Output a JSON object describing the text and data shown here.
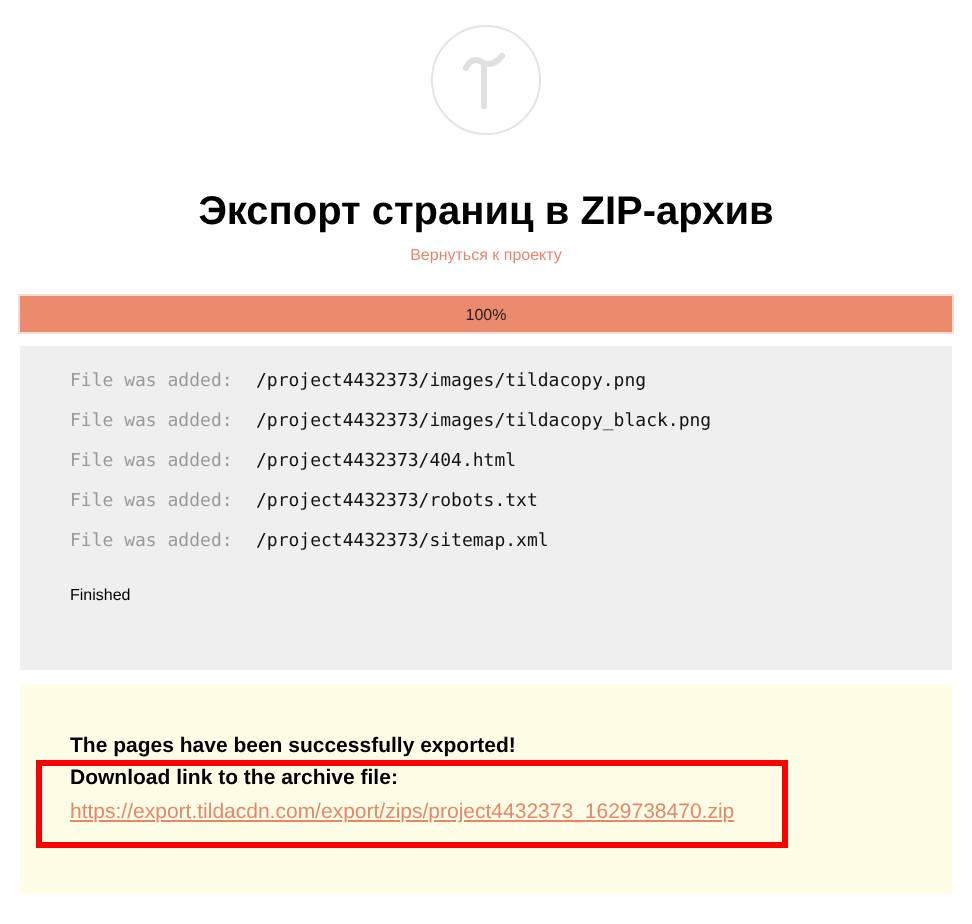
{
  "title": "Экспорт страниц в ZIP-архив",
  "back_link": "Вернуться к проекту",
  "progress": {
    "level": 1,
    "label": "100%"
  },
  "log": {
    "rows": [
      {
        "prefix": "File was added:",
        "path": "/project4432373/images/tildacopy.png"
      },
      {
        "prefix": "File was added:",
        "path": "/project4432373/images/tildacopy_black.png"
      },
      {
        "prefix": "File was added:",
        "path": "/project4432373/404.html"
      },
      {
        "prefix": "File was added:",
        "path": "/project4432373/robots.txt"
      },
      {
        "prefix": "File was added:",
        "path": "/project4432373/sitemap.xml"
      }
    ],
    "status": "Finished"
  },
  "result": {
    "message": "The pages have been successfully exported!",
    "link_label": "Download link to the archive file:",
    "link": "https://export.tildacdn.com/export/zips/project4432373_1629738470.zip"
  }
}
